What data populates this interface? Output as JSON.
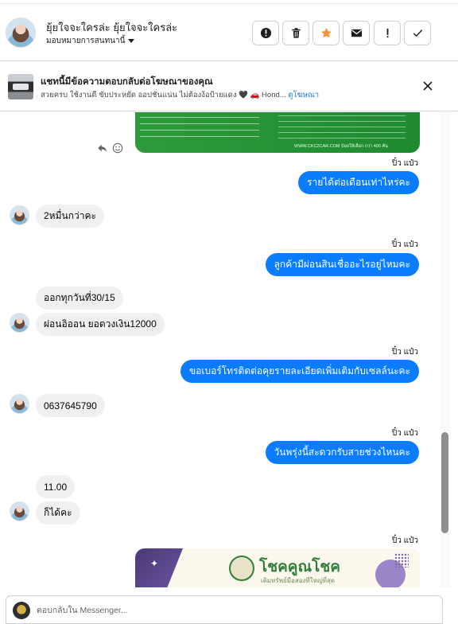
{
  "header": {
    "contact_name": "ยุ้ยใจจะใครล่ะ ยุ้ยใจจะใครล่ะ",
    "assign_label": "มอบหมายการสนทนานี้"
  },
  "ad_banner": {
    "title": "แชทนี้มีข้อความตอบกลับต่อโฆษณาของคุณ",
    "subtitle": "สวยครบ ใช้งานดี ขับประหยัด ออปชั่นแน่น ไม่ต้องง้อป้ายแดง 🖤 🚗 Hond...",
    "link": "ดูโฆษณา"
  },
  "ad_card": {
    "url_text": "WWW.CKC2CAR.COM  บ้อยให้เลือก กว่า 400 คัน"
  },
  "messages": [
    {
      "sender": "ปิ๋ว แป๋ว",
      "text": "รายได้ต่อเดือนเท่าไหร่คะ",
      "direction": "out"
    },
    {
      "text": "2หมื่นกว่าคะ",
      "direction": "in"
    },
    {
      "sender": "ปิ๋ว แป๋ว",
      "text": "ลูกค้ามีผ่อนสินเชื่ออะไรอยู่ไหมคะ",
      "direction": "out"
    },
    {
      "text": "ออกทุกวันที่30/15",
      "direction": "in"
    },
    {
      "text": "ผ่อนอิออน ยอดวงเงิน12000",
      "direction": "in"
    },
    {
      "sender": "ปิ๋ว แป๋ว",
      "text": "ขอเบอร์โทรติดต่อคุยรายละเอียดเพิ่มเติมกับเซลล์นะคะ",
      "direction": "out"
    },
    {
      "text": "0637645790",
      "direction": "in"
    },
    {
      "sender": "ปิ๋ว แป๋ว",
      "text": "วันพรุ่งนี้สะดวกรับสายช่วงไหนคะ",
      "direction": "out"
    },
    {
      "text": "11.00",
      "direction": "in"
    },
    {
      "text": "ก็ได้คะ",
      "direction": "in"
    },
    {
      "sender": "ปิ๋ว แป๋ว",
      "direction": "out"
    }
  ],
  "promo_card": {
    "title": "โชคคูณโชค",
    "subtitle": "เติมทรัพย์มือสองที่ใหญ่ที่สุด"
  },
  "composer": {
    "placeholder": "ตอบกลับใน Messenger..."
  },
  "colors": {
    "outgoing_bubble": "#0a7cff",
    "incoming_bubble": "#f0f0f0",
    "star_action": "#f7923b"
  },
  "icons": [
    "alert-icon",
    "trash-icon",
    "star-icon",
    "mail-icon",
    "exclamation-icon",
    "check-icon",
    "close-icon",
    "reply-icon",
    "emoji-icon"
  ]
}
